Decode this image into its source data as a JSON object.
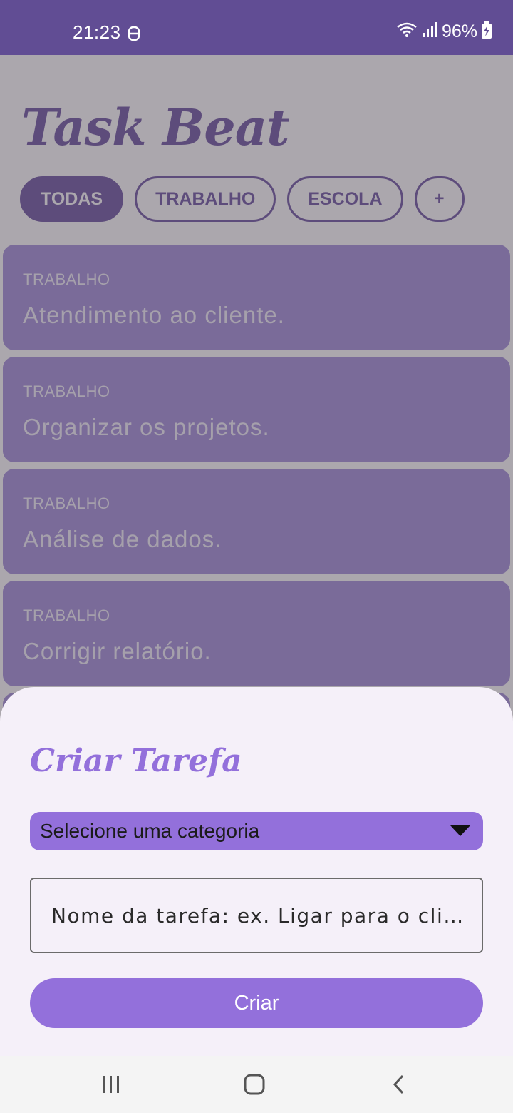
{
  "status_bar": {
    "time": "21:23",
    "battery": "96%",
    "icons": [
      "notification-icon",
      "wifi-icon",
      "signal-icon",
      "battery-charging-icon"
    ]
  },
  "app": {
    "title": "Task Beat",
    "chips": [
      {
        "label": "TODAS",
        "active": true
      },
      {
        "label": "TRABALHO",
        "active": false
      },
      {
        "label": "ESCOLA",
        "active": false
      },
      {
        "label": "+",
        "active": false
      }
    ],
    "tasks": [
      {
        "category": "TRABALHO",
        "name": "Atendimento ao cliente."
      },
      {
        "category": "TRABALHO",
        "name": "Organizar os projetos."
      },
      {
        "category": "TRABALHO",
        "name": "Análise de dados."
      },
      {
        "category": "TRABALHO",
        "name": "Corrigir relatório."
      }
    ]
  },
  "sheet": {
    "title": "Criar Tarefa",
    "category_select": "Selecione uma categoria",
    "task_placeholder": "Nome da tarefa: ex. Ligar para o cli…",
    "create_label": "Criar"
  },
  "nav_bar": {
    "icons": [
      "recent-apps-icon",
      "home-icon",
      "back-icon"
    ]
  },
  "colors": {
    "primary": "#63489a",
    "accent": "#9370db",
    "status_bar": "#614d94",
    "sheet_bg": "#f5f0f9"
  }
}
